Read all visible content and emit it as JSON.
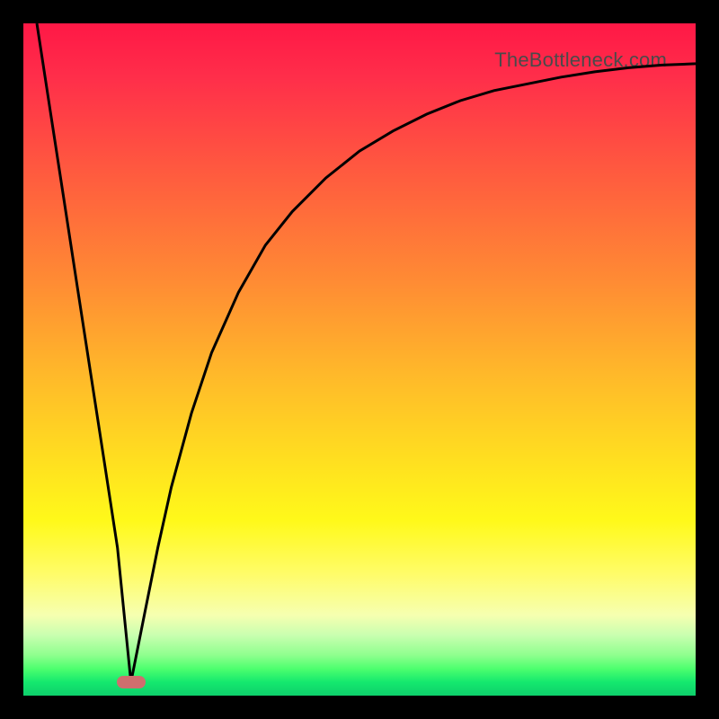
{
  "watermark": "TheBottleneck.com",
  "colors": {
    "curve_stroke": "#000000",
    "marker_fill": "#cf6e6e",
    "frame_bg": "#000000"
  },
  "chart_data": {
    "type": "line",
    "title": "",
    "xlabel": "",
    "ylabel": "",
    "xlim": [
      0,
      100
    ],
    "ylim": [
      0,
      100
    ],
    "grid": false,
    "series": [
      {
        "name": "left-branch",
        "x": [
          2,
          4,
          6,
          8,
          10,
          12,
          14,
          16
        ],
        "values": [
          100,
          87,
          74,
          61,
          48,
          35,
          22,
          2
        ]
      },
      {
        "name": "right-branch",
        "x": [
          16,
          18,
          20,
          22,
          25,
          28,
          32,
          36,
          40,
          45,
          50,
          55,
          60,
          65,
          70,
          75,
          80,
          85,
          90,
          95,
          100
        ],
        "values": [
          2,
          12,
          22,
          31,
          42,
          51,
          60,
          67,
          72,
          77,
          81,
          84,
          86.5,
          88.5,
          90,
          91,
          92,
          92.8,
          93.4,
          93.8,
          94
        ]
      }
    ],
    "marker": {
      "x": 16,
      "y": 2,
      "shape": "pill",
      "color": "#cf6e6e"
    }
  }
}
